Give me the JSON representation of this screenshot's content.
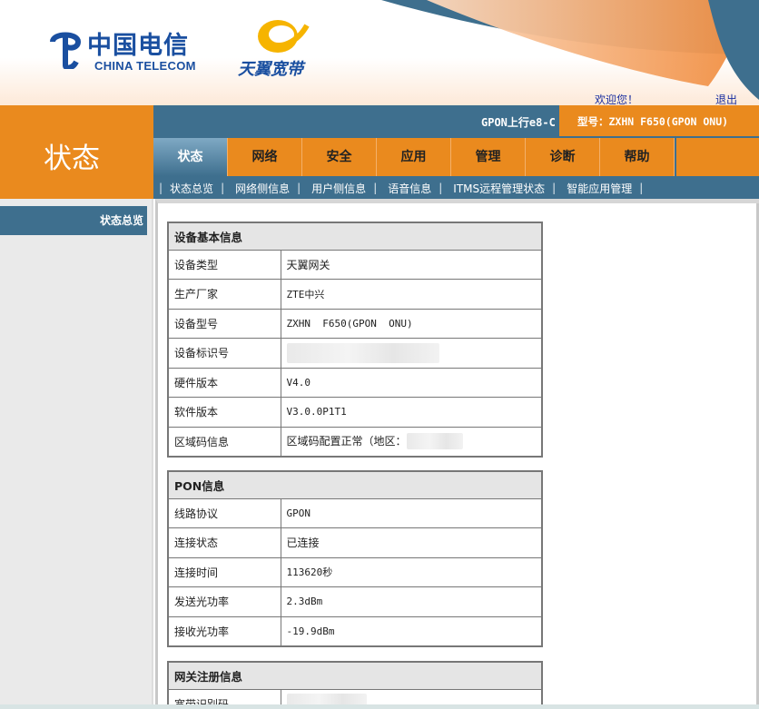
{
  "header": {
    "brand_cn": "中国电信",
    "brand_en": "CHINA TELECOM",
    "tianyi": "天翼宽带",
    "welcome": "欢迎您！",
    "logout": "退出"
  },
  "page_title": "状态",
  "model_line": "GPON上行e8-C",
  "model_badge": "型号：ZXHN  F650(GPON ONU)",
  "tabs": [
    {
      "label": "状态",
      "active": true
    },
    {
      "label": "网络"
    },
    {
      "label": "安全"
    },
    {
      "label": "应用"
    },
    {
      "label": "管理"
    },
    {
      "label": "诊断"
    },
    {
      "label": "帮助"
    }
  ],
  "subnav": [
    "状态总览",
    "网络侧信息",
    "用户侧信息",
    "语音信息",
    "ITMS远程管理状态",
    "智能应用管理"
  ],
  "sidebar": {
    "active_item": "状态总览"
  },
  "device": {
    "title": "设备基本信息",
    "rows": [
      {
        "label": "设备类型",
        "value": "天翼网关"
      },
      {
        "label": "生产厂家",
        "value": "ZTE中兴"
      },
      {
        "label": "设备型号",
        "value": "ZXHN  F650(GPON  ONU)"
      },
      {
        "label": "设备标识号",
        "value": ""
      },
      {
        "label": "硬件版本",
        "value": "V4.0"
      },
      {
        "label": "软件版本",
        "value": "V3.0.0P1T1"
      },
      {
        "label": "区域码信息",
        "value": "区域码配置正常（地区："
      }
    ]
  },
  "pon": {
    "title": "PON信息",
    "rows": [
      {
        "label": "线路协议",
        "value": "GPON"
      },
      {
        "label": "连接状态",
        "value": "已连接"
      },
      {
        "label": "连接时间",
        "value": "113620秒"
      },
      {
        "label": "发送光功率",
        "value": "2.3dBm"
      },
      {
        "label": "接收光功率",
        "value": "-19.9dBm"
      }
    ]
  },
  "gateway": {
    "title": "网关注册信息",
    "rows": [
      {
        "label": "宽带识别码",
        "value": ""
      }
    ]
  },
  "colors": {
    "orange": "#ea8a1e",
    "blue": "#3e6f8e",
    "link": "#1a2fa0"
  }
}
